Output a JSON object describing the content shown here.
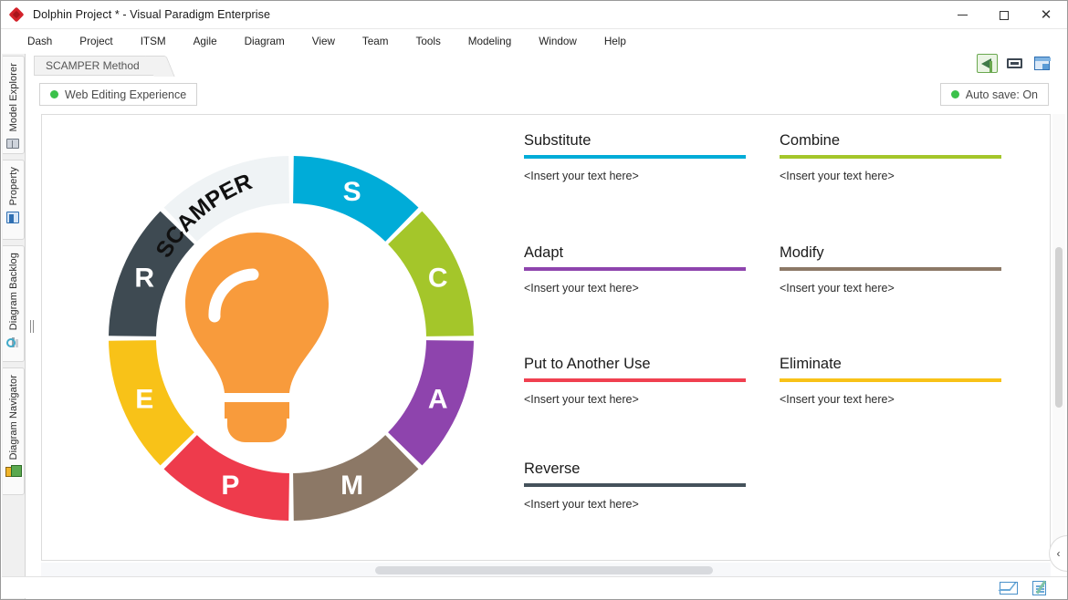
{
  "window": {
    "title": "Dolphin Project * - Visual Paradigm Enterprise",
    "app_icon": "diamond-logo-icon",
    "controls": {
      "minimize": "minimize-icon",
      "maximize": "maximize-icon",
      "close": "close-icon"
    }
  },
  "menu": {
    "items": [
      "Dash",
      "Project",
      "ITSM",
      "Agile",
      "Diagram",
      "View",
      "Team",
      "Tools",
      "Modeling",
      "Window",
      "Help"
    ]
  },
  "breadcrumb": {
    "label": "SCAMPER Method"
  },
  "toolbar": {
    "buttons": [
      {
        "name": "announce-icon",
        "label": ""
      },
      {
        "name": "fit-to-screen-icon",
        "label": ""
      },
      {
        "name": "layers-icon",
        "label": ""
      }
    ]
  },
  "status_pills": {
    "web_editing": {
      "label": "Web Editing Experience",
      "dot_color": "#3bc14a"
    },
    "auto_save": {
      "label": "Auto save: On",
      "dot_color": "#3bc14a"
    }
  },
  "sidebar": {
    "items": [
      {
        "label": "Model Explorer",
        "icon": "model-explorer-icon"
      },
      {
        "label": "Property",
        "icon": "property-icon"
      },
      {
        "label": "Diagram Backlog",
        "icon": "diagram-backlog-icon"
      },
      {
        "label": "Diagram Navigator",
        "icon": "diagram-navigator-icon"
      }
    ]
  },
  "diagram": {
    "center_label": "SCAMPER",
    "center_icon": "lightbulb-icon",
    "wheel_segments": [
      {
        "letter": "S",
        "color": "#00ACD8",
        "name": "substitute"
      },
      {
        "letter": "C",
        "color": "#A4C62A",
        "name": "combine"
      },
      {
        "letter": "A",
        "color": "#8E44AD",
        "name": "adapt"
      },
      {
        "letter": "M",
        "color": "#8C7866",
        "name": "modify"
      },
      {
        "letter": "P",
        "color": "#EE3B4C",
        "name": "put-to-another-use"
      },
      {
        "letter": "E",
        "color": "#F8C218",
        "name": "eliminate"
      },
      {
        "letter": "R",
        "color": "#3E4A52",
        "name": "reverse"
      },
      {
        "letter": "",
        "color": "#EFF3F5",
        "name": "title-segment"
      }
    ],
    "bulb_color": "#F89B3C",
    "sections": [
      {
        "title": "Substitute",
        "color": "#00ACD8",
        "text": "<Insert your text here>",
        "col": 0,
        "row": 0
      },
      {
        "title": "Combine",
        "color": "#A4C62A",
        "text": "<Insert your text here>",
        "col": 1,
        "row": 0
      },
      {
        "title": "Adapt",
        "color": "#8E44AD",
        "text": "<Insert your text here>",
        "col": 0,
        "row": 1
      },
      {
        "title": "Modify",
        "color": "#8C7866",
        "text": "<Insert your text here>",
        "col": 1,
        "row": 1
      },
      {
        "title": "Put to Another Use",
        "color": "#F04050",
        "text": "<Insert your text here>",
        "col": 0,
        "row": 2
      },
      {
        "title": "Eliminate",
        "color": "#F8C218",
        "text": "<Insert your text here>",
        "col": 1,
        "row": 2
      },
      {
        "title": "Reverse",
        "color": "#45525B",
        "text": "<Insert your text here>",
        "col": 0,
        "row": 3
      }
    ]
  },
  "statusbar": {
    "icons": [
      {
        "name": "mail-icon"
      },
      {
        "name": "note-icon"
      }
    ]
  },
  "scroll": {
    "collapse_chevron": "‹"
  }
}
